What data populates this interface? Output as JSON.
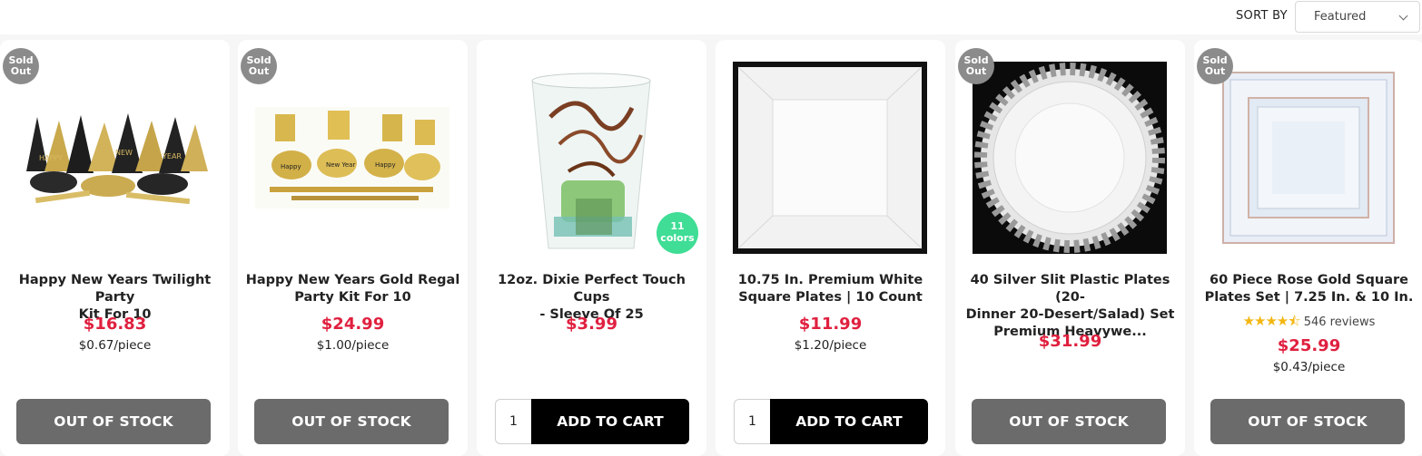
{
  "sort": {
    "label": "SORT BY",
    "selected": "Featured"
  },
  "badges": {
    "sold_out_line1": "Sold",
    "sold_out_line2": "Out"
  },
  "buttons": {
    "out_of_stock": "OUT OF STOCK",
    "add_to_cart": "ADD TO CART"
  },
  "products": [
    {
      "title_l1": "Happy New Years Twilight Party",
      "title_l2": "Kit For 10",
      "price": "$16.83",
      "per_piece": "$0.67/piece",
      "sold_out": true
    },
    {
      "title_l1": "Happy New Years Gold Regal",
      "title_l2": "Party Kit For 10",
      "price": "$24.99",
      "per_piece": "$1.00/piece",
      "sold_out": true
    },
    {
      "title_l1": "12oz. Dixie Perfect Touch Cups",
      "title_l2": "- Sleeve Of 25",
      "price": "$3.99",
      "qty": "1",
      "colors_badge_l1": "11",
      "colors_badge_l2": "colors",
      "sold_out": false
    },
    {
      "title_l1": "10.75 In. Premium White",
      "title_l2": "Square Plates | 10 Count",
      "price": "$11.99",
      "per_piece": "$1.20/piece",
      "qty": "1",
      "sold_out": false
    },
    {
      "title_l1": "40 Silver Slit Plastic Plates (20-",
      "title_l2": "Dinner 20-Desert/Salad) Set",
      "title_l3": "Premium Heavywe...",
      "price": "$31.99",
      "sold_out": true
    },
    {
      "title_l1": "60 Piece Rose Gold Square",
      "title_l2": "Plates Set | 7.25 In. & 10 In.",
      "rating_stars": "★★★★⯪",
      "rating": 4.5,
      "reviews": "546 reviews",
      "price": "$25.99",
      "per_piece": "$0.43/piece",
      "sold_out": true
    }
  ]
}
